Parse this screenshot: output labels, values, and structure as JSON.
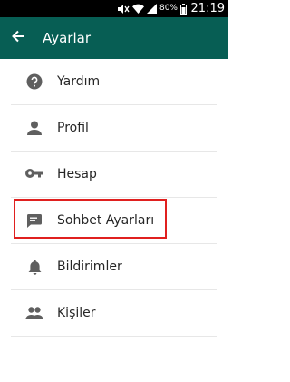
{
  "status_bar": {
    "battery_percent": "80%",
    "time": "21:19",
    "icons": [
      "mute-icon",
      "wifi-icon",
      "signal-icon",
      "battery-icon"
    ]
  },
  "app_bar": {
    "title": "Ayarlar",
    "back_icon": "arrow-back-icon",
    "color": "#075e54"
  },
  "settings": {
    "items": [
      {
        "label": "Yardım",
        "icon": "help-icon"
      },
      {
        "label": "Profil",
        "icon": "person-icon"
      },
      {
        "label": "Hesap",
        "icon": "key-icon"
      },
      {
        "label": "Sohbet Ayarları",
        "icon": "chat-icon",
        "highlighted": true
      },
      {
        "label": "Bildirimler",
        "icon": "bell-icon"
      },
      {
        "label": "Kişiler",
        "icon": "contacts-icon"
      }
    ],
    "icon_color": "#5f5f5f",
    "highlight_color": "#e0201f"
  }
}
